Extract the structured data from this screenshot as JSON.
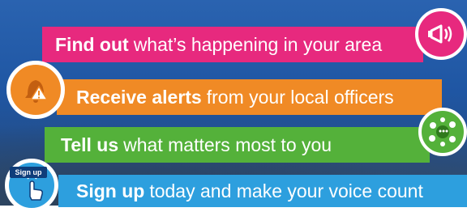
{
  "rows": [
    {
      "bold": "Find out",
      "rest": "what’s happening in your area",
      "color": "#e7297e",
      "icon": "megaphone-icon"
    },
    {
      "bold": "Receive alerts",
      "rest": "from your local officers",
      "color": "#f08a25",
      "icon": "alert-bell-icon"
    },
    {
      "bold": "Tell us",
      "rest": "what matters most to you",
      "color": "#54b13a",
      "icon": "speech-bubbles-icon"
    },
    {
      "bold": "Sign up",
      "rest": "today and make your voice count",
      "color": "#2d9fde",
      "icon": "sign-up-tap-icon"
    }
  ],
  "signup_badge": "Sign up"
}
